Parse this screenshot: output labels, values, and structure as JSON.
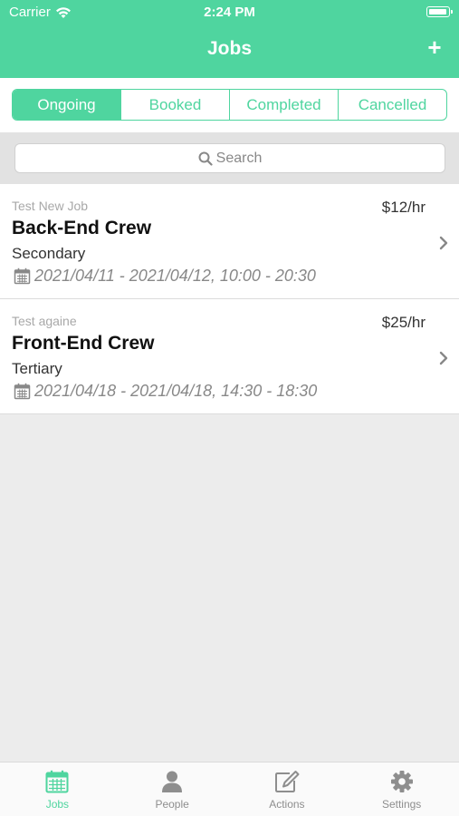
{
  "colors": {
    "accent": "#4fd59f",
    "background": "#ececec",
    "inactive": "#8e8e8e"
  },
  "status_bar": {
    "carrier": "Carrier",
    "time": "2:24 PM"
  },
  "nav": {
    "title": "Jobs",
    "add_label": "+"
  },
  "segments": [
    {
      "label": "Ongoing",
      "selected": true
    },
    {
      "label": "Booked",
      "selected": false
    },
    {
      "label": "Completed",
      "selected": false
    },
    {
      "label": "Cancelled",
      "selected": false
    }
  ],
  "search": {
    "placeholder": "Search"
  },
  "jobs": [
    {
      "subtitle": "Test New Job",
      "rate": "$12/hr",
      "title": "Back-End Crew",
      "level": "Secondary",
      "dates": "2021/04/11 - 2021/04/12, 10:00 - 20:30"
    },
    {
      "subtitle": "Test againe",
      "rate": "$25/hr",
      "title": "Front-End Crew",
      "level": "Tertiary",
      "dates": "2021/04/18 - 2021/04/18, 14:30 - 18:30"
    }
  ],
  "tabs": [
    {
      "label": "Jobs",
      "icon": "calendar-icon",
      "active": true
    },
    {
      "label": "People",
      "icon": "person-icon",
      "active": false
    },
    {
      "label": "Actions",
      "icon": "edit-icon",
      "active": false
    },
    {
      "label": "Settings",
      "icon": "gear-icon",
      "active": false
    }
  ]
}
